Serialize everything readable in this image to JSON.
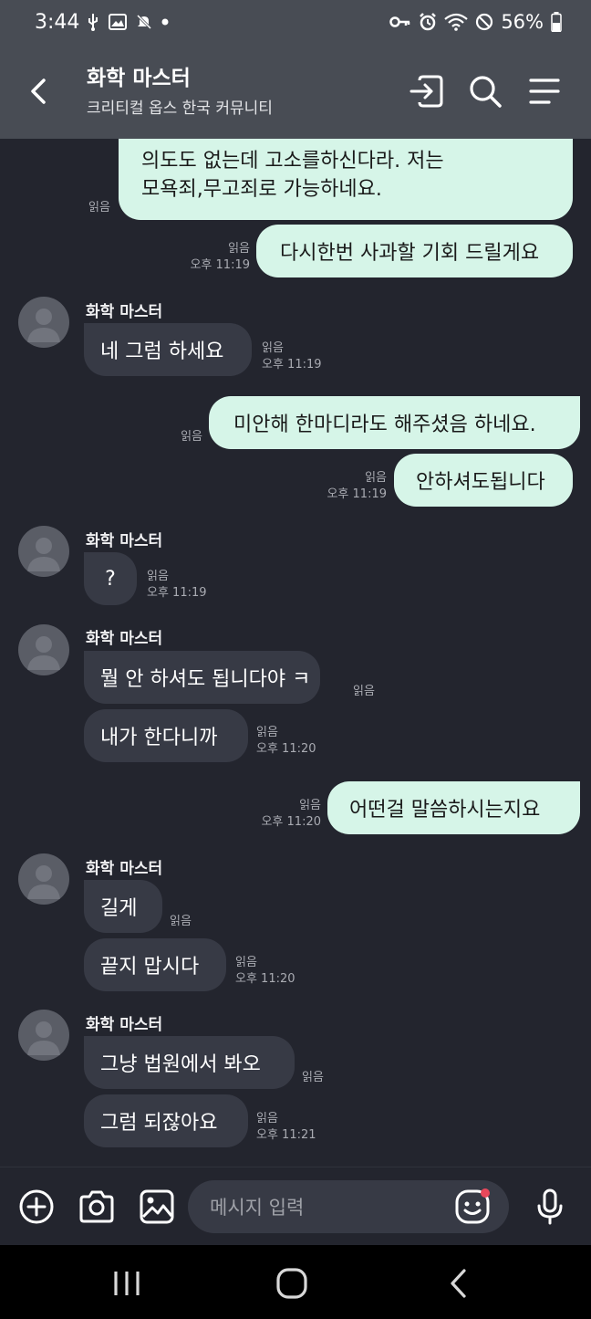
{
  "status_bar": {
    "time": "3:44",
    "battery": "56%"
  },
  "header": {
    "title": "화학 마스터",
    "subtitle": "크리티컬 옵스 한국 커뮤니티"
  },
  "messages": {
    "m1": {
      "line1": "의도도 없는데 고소를하신다라. 저는",
      "line2": "모욕죄,무고죄로 가능하네요.",
      "read": "읽음"
    },
    "m2": {
      "text": "다시한번 사과할 기회 드릴게요",
      "read": "읽음",
      "time": "오후 11:19"
    },
    "g1": {
      "sender": "화학 마스터",
      "text": "네 그럼 하세요",
      "read": "읽음",
      "time": "오후 11:19"
    },
    "m3": {
      "text": "미안해 한마디라도 해주셨음 하네요.",
      "read": "읽음"
    },
    "m4": {
      "text": "안하셔도됩니다",
      "read": "읽음",
      "time": "오후 11:19"
    },
    "g2": {
      "sender": "화학 마스터",
      "text": "?",
      "read": "읽음",
      "time": "오후 11:19"
    },
    "g3": {
      "sender": "화학 마스터",
      "text1": "뭘 안 하셔도 됩니다야 ㅋ",
      "read1": "읽음",
      "text2": "내가 한다니까",
      "read2": "읽음",
      "time2": "오후 11:20"
    },
    "m5": {
      "text": "어떤걸 말씀하시는지요",
      "read": "읽음",
      "time": "오후 11:20"
    },
    "g4": {
      "sender": "화학 마스터",
      "text1": "길게",
      "read1": "읽음",
      "text2": "끝지 맙시다",
      "read2": "읽음",
      "time2": "오후 11:20"
    },
    "g5": {
      "sender": "화학 마스터",
      "text1": "그냥 법원에서 봐오",
      "read1": "읽음",
      "text2": "그럼 되잖아요",
      "read2": "읽음",
      "time2": "오후 11:21"
    }
  },
  "input": {
    "placeholder": "메시지 입력",
    "value": ""
  },
  "colors": {
    "background": "#23252e",
    "header": "#484c54",
    "outgoing_bubble": "#d6f5e8",
    "incoming_bubble": "#373a45",
    "notification_dot": "#e8485b"
  },
  "icons": [
    "usb-icon",
    "image-icon",
    "mute-icon",
    "dot-icon",
    "key-icon",
    "alarm-icon",
    "wifi-icon",
    "dnd-icon",
    "battery-icon",
    "back-arrow-icon",
    "enter-icon",
    "search-icon",
    "menu-icon",
    "plus-icon",
    "camera-icon",
    "gallery-icon",
    "emoji-icon",
    "mic-icon",
    "recent-apps-icon",
    "home-icon",
    "nav-back-icon"
  ]
}
